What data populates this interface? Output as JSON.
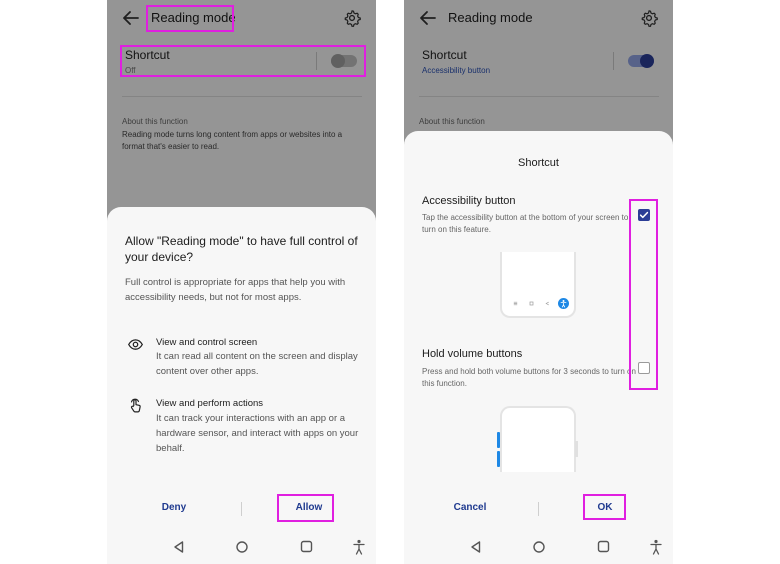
{
  "left_screen": {
    "title": "Reading mode",
    "shortcut": {
      "label": "Shortcut",
      "status": "Off",
      "enabled": false
    },
    "about": {
      "heading": "About this function",
      "body": "Reading mode turns long content from apps or websites into a format that's easier to read."
    },
    "dialog": {
      "title": "Allow \"Reading mode\" to have full control of your device?",
      "description": "Full control is appropriate for apps that help you with accessibility needs, but not for most apps.",
      "permissions": [
        {
          "icon": "eye-icon",
          "heading": "View and control screen",
          "text": "It can read all content on the screen and display content over other apps."
        },
        {
          "icon": "touch-hand-icon",
          "heading": "View and perform actions",
          "text": "It can track your interactions with an app or a hardware sensor, and interact with apps on your behalf."
        }
      ],
      "deny_label": "Deny",
      "allow_label": "Allow"
    }
  },
  "right_screen": {
    "title": "Reading mode",
    "shortcut": {
      "label": "Shortcut",
      "status": "Accessibility button",
      "enabled": true
    },
    "about": {
      "heading": "About this function"
    },
    "dialog": {
      "title": "Shortcut",
      "options": [
        {
          "label": "Accessibility button",
          "description": "Tap the accessibility button at the bottom of your screen to turn on this feature.",
          "checked": true
        },
        {
          "label": "Hold volume buttons",
          "description": "Press and hold both volume buttons for 3 seconds to turn on this function.",
          "checked": false
        }
      ],
      "cancel_label": "Cancel",
      "ok_label": "OK"
    }
  },
  "nav_icons": [
    "back-triangle-icon",
    "home-circle-icon",
    "recents-square-icon",
    "accessibility-person-icon"
  ],
  "colors": {
    "accent": "#2b3d96",
    "link_blue": "#2a4fb0",
    "highlight": "#e01fe0",
    "dim_overlay": "rgba(0,0,0,0.39)",
    "toggle_off_track": "#bdbdbd",
    "toggle_on_track": "#8fa1e0"
  }
}
